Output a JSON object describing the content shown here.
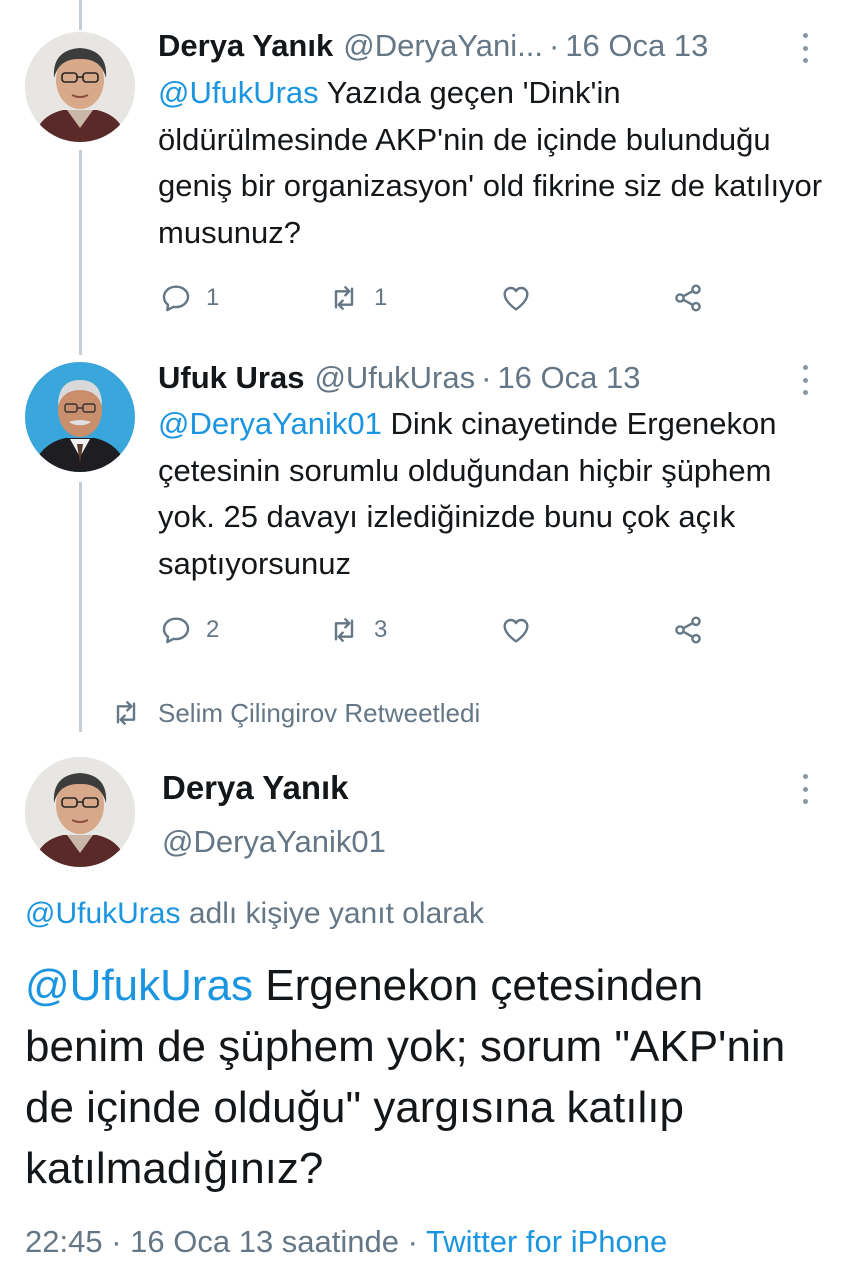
{
  "thread": [
    {
      "name": "Derya Yanık",
      "handle": "@DeryaYani...",
      "separator": "·",
      "date": "16 Oca 13",
      "mention": "@UfukUras",
      "text": " Yazıda geçen 'Dink'in öldürülmesinde AKP'nin de içinde bulunduğu geniş bir organizasyon' old fikrine siz de katılıyor musunuz?",
      "reply_count": "1",
      "retweet_count": "1",
      "like_count": ""
    },
    {
      "name": "Ufuk Uras",
      "handle": "@UfukUras",
      "separator": "·",
      "date": "16 Oca 13",
      "mention": "@DeryaYanik01",
      "text": " Dink cinayetinde Ergenekon çetesinin sorumlu olduğundan hiçbir şüphem yok. 25 davayı izlediğinizde bunu çok açık saptıyorsunuz",
      "reply_count": "2",
      "retweet_count": "3",
      "like_count": ""
    }
  ],
  "retweet_banner": {
    "icon": "retweet-icon",
    "text": "Selim Çilingirov Retweetledi"
  },
  "main_tweet": {
    "name": "Derya Yanık",
    "handle": "@DeryaYanik01",
    "reply_to_mention": "@UfukUras",
    "reply_to_text": " adlı kişiye yanıt olarak",
    "mention": "@UfukUras",
    "text": " Ergenekon çetesinden benim de şüphem yok; sorum \"AKP'nin de içinde olduğu\" yargısına katılıp katılmadığınız?",
    "time": "22:45",
    "sep1": " · ",
    "date": "16 Oca 13 saatinde",
    "sep2": " · ",
    "source": "Twitter for iPhone"
  },
  "colors": {
    "link": "#1b95e0",
    "secondary_text": "#657786",
    "icon": "#657786",
    "thread_line": "#c4cfd6"
  },
  "icons": [
    "reply-icon",
    "retweet-icon",
    "like-icon",
    "share-icon",
    "more-options-icon"
  ]
}
